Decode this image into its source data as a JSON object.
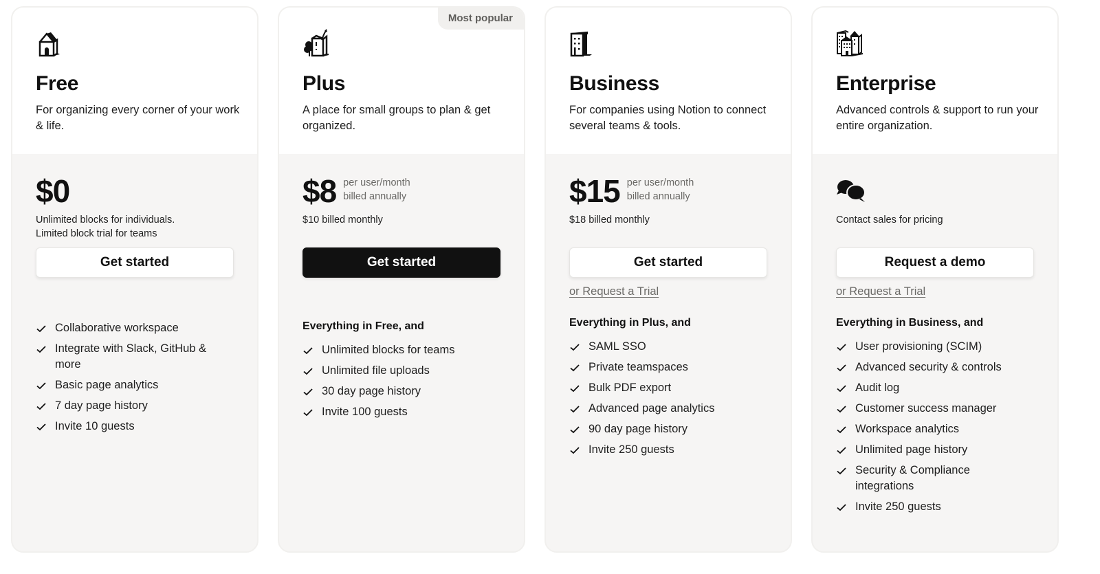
{
  "plans": [
    {
      "id": "free",
      "icon": "house-icon",
      "name": "Free",
      "description": "For organizing every corner of your work & life.",
      "price": "$0",
      "price_note_line1": "",
      "price_note_line2": "",
      "sub_price": "Unlimited blocks for individuals. Limited block trial for teams",
      "cta_label": "Get started",
      "cta_style": "light",
      "trial_link": "",
      "features_heading": "",
      "features": [
        "Collaborative workspace",
        "Integrate with Slack, GitHub & more",
        "Basic page analytics",
        "7 day page history",
        "Invite 10 guests"
      ]
    },
    {
      "id": "plus",
      "icon": "house-with-tree-icon",
      "badge": "Most popular",
      "name": "Plus",
      "description": "A place for small groups to plan & get organized.",
      "price": "$8",
      "price_note_line1": "per user/month",
      "price_note_line2": "billed annually",
      "sub_price": "$10 billed monthly",
      "cta_label": "Get started",
      "cta_style": "dark",
      "trial_link": "",
      "features_heading": "Everything in Free, and",
      "features": [
        "Unlimited blocks for teams",
        "Unlimited file uploads",
        "30 day page history",
        "Invite 100 guests"
      ]
    },
    {
      "id": "business",
      "icon": "office-building-icon",
      "name": "Business",
      "description": "For companies using Notion to connect several teams & tools.",
      "price": "$15",
      "price_note_line1": "per user/month",
      "price_note_line2": "billed annually",
      "sub_price": "$18 billed monthly",
      "cta_label": "Get started",
      "cta_style": "light",
      "trial_link": "or Request a Trial",
      "features_heading": "Everything in Plus, and",
      "features": [
        "SAML SSO",
        "Private teamspaces",
        "Bulk PDF export",
        "Advanced page analytics",
        "90 day page history",
        "Invite 250 guests"
      ]
    },
    {
      "id": "enterprise",
      "icon": "city-buildings-icon",
      "name": "Enterprise",
      "description": "Advanced controls & support to run your entire organization.",
      "price_icon": "chat-bubbles-icon",
      "sub_price": "Contact sales for pricing",
      "cta_label": "Request a demo",
      "cta_style": "light",
      "trial_link": "or Request a Trial",
      "features_heading": "Everything in Business, and",
      "features": [
        "User provisioning (SCIM)",
        "Advanced security & controls",
        "Audit log",
        "Customer success manager",
        "Workspace analytics",
        "Unlimited page history",
        "Security & Compliance integrations",
        "Invite 250 guests"
      ]
    }
  ],
  "colors": {
    "card_top": "#ffffff",
    "card_bottom": "#f6f5f4",
    "card_border": "#f1f0ee",
    "primary_button": "#111111",
    "muted_text": "#6b6a67"
  }
}
